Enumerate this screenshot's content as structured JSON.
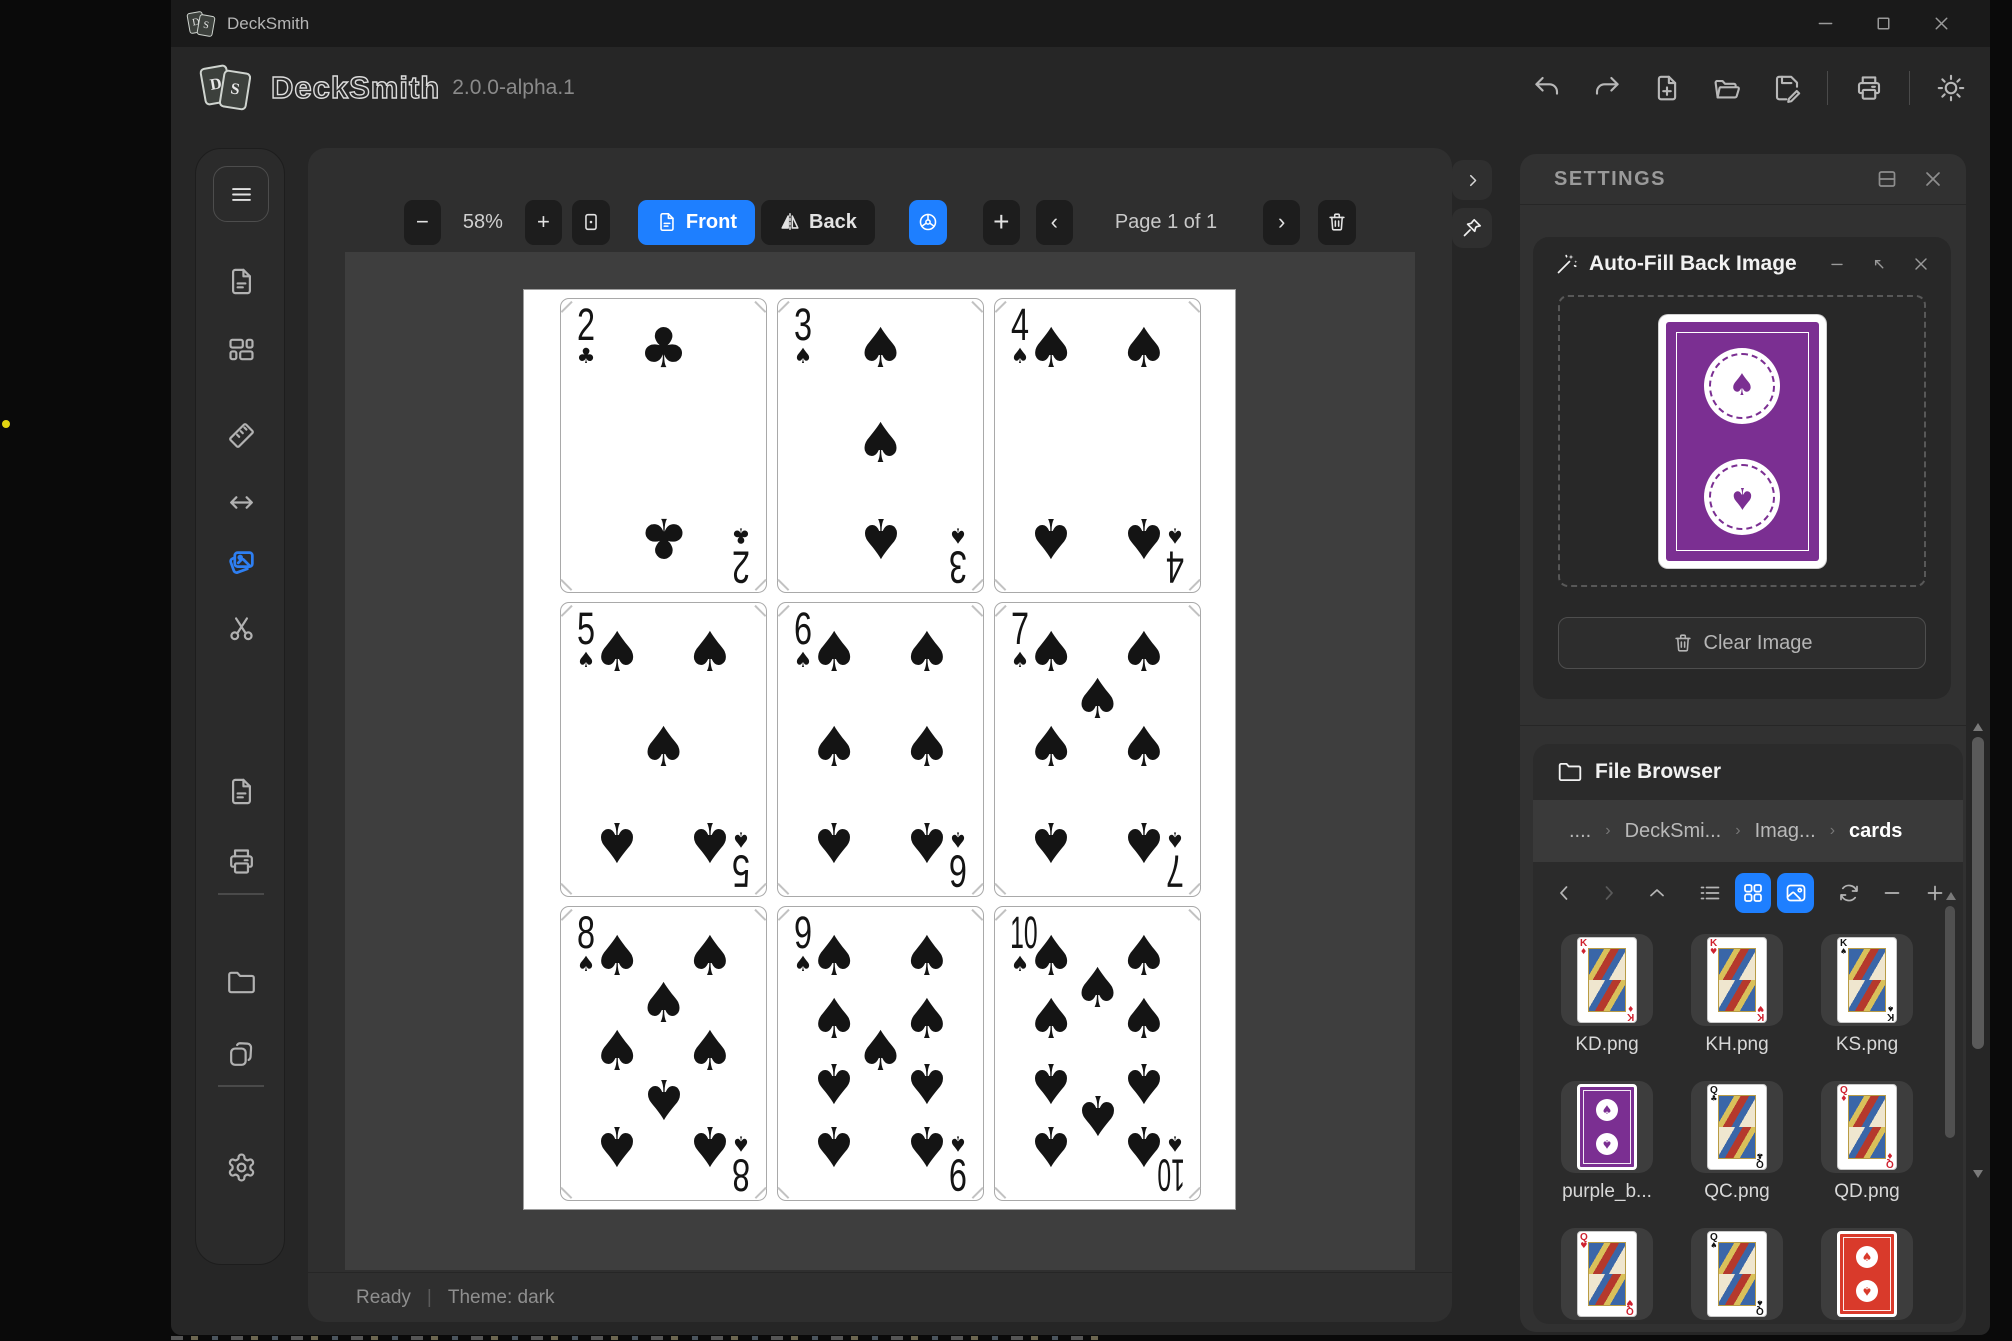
{
  "window": {
    "title": "DeckSmith"
  },
  "titlebar": {
    "controls": [
      "minimize",
      "maximize",
      "close"
    ]
  },
  "header": {
    "app_name": "DeckSmith",
    "version": "2.0.0-alpha.1",
    "toolbar": [
      "undo",
      "redo",
      "file-plus",
      "folder-open",
      "save",
      "sep",
      "printer",
      "sep",
      "sun"
    ]
  },
  "sidebar": {
    "menu_icon": "hamburger",
    "items": [
      {
        "icon": "file-text",
        "active": false
      },
      {
        "icon": "layout",
        "active": false
      },
      {
        "icon": "ruler",
        "active": false
      },
      {
        "icon": "move-horizontal",
        "active": false
      },
      {
        "icon": "images",
        "active": true
      },
      {
        "icon": "scissors",
        "active": false
      },
      {
        "icon": "file-text",
        "active": false
      },
      {
        "icon": "printer",
        "active": false
      },
      {
        "icon": "divider",
        "active": false
      },
      {
        "icon": "folder",
        "active": false
      },
      {
        "icon": "copy",
        "active": false
      },
      {
        "icon": "divider",
        "active": false
      },
      {
        "icon": "gear",
        "active": false
      }
    ]
  },
  "canvas": {
    "toolbar": {
      "zoom_out": "−",
      "zoom_level": "58%",
      "zoom_in": "+",
      "front_label": "Front",
      "back_label": "Back",
      "add_page": "+",
      "prev": "‹",
      "page_indicator": "Page 1 of 1",
      "next": "›"
    },
    "cards": [
      {
        "rank": "2",
        "suit": "club"
      },
      {
        "rank": "3",
        "suit": "spade"
      },
      {
        "rank": "4",
        "suit": "spade"
      },
      {
        "rank": "5",
        "suit": "spade"
      },
      {
        "rank": "6",
        "suit": "spade"
      },
      {
        "rank": "7",
        "suit": "spade"
      },
      {
        "rank": "8",
        "suit": "spade"
      },
      {
        "rank": "9",
        "suit": "spade"
      },
      {
        "rank": "10",
        "suit": "spade"
      }
    ],
    "status": {
      "state": "Ready",
      "divider": "|",
      "theme": "Theme: dark"
    }
  },
  "settings": {
    "title": "SETTINGS",
    "autofill": {
      "title": "Auto-Fill Back Image",
      "clear_label": "Clear Image",
      "back_color": "#7b2f92"
    },
    "file_browser": {
      "title": "File Browser",
      "breadcrumb": [
        "....",
        "DeckSmi...",
        "Imag...",
        "cards"
      ],
      "toolbar": [
        "chevron-left",
        "chevron-right",
        "chevron-up",
        "list",
        "grid",
        "image",
        "refresh",
        "minus",
        "plus"
      ],
      "files": [
        {
          "name": "KD.png",
          "type": "court",
          "rank": "K",
          "suit": "diamond"
        },
        {
          "name": "KH.png",
          "type": "court",
          "rank": "K",
          "suit": "heart"
        },
        {
          "name": "KS.png",
          "type": "court",
          "rank": "K",
          "suit": "spade"
        },
        {
          "name": "purple_b...",
          "type": "back",
          "color": "#7b2f92"
        },
        {
          "name": "QC.png",
          "type": "court",
          "rank": "Q",
          "suit": "club"
        },
        {
          "name": "QD.png",
          "type": "court",
          "rank": "Q",
          "suit": "diamond"
        },
        {
          "name": "",
          "type": "court",
          "rank": "Q",
          "suit": "heart"
        },
        {
          "name": "",
          "type": "court",
          "rank": "Q",
          "suit": "spade"
        },
        {
          "name": "",
          "type": "back",
          "color": "#d93a2b"
        }
      ]
    }
  },
  "colors": {
    "accent": "#1e7fff",
    "purple": "#7b2f92",
    "card_red": "#cf2230",
    "card_black": "#141414"
  }
}
